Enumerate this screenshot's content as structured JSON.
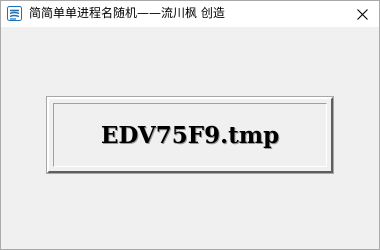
{
  "window": {
    "title": "简简单单进程名随机——流川枫 创造",
    "app_icon": "stacked-lines-app-icon",
    "close_icon": "close-icon"
  },
  "main": {
    "process_name": "EDV75F9.tmp"
  },
  "colors": {
    "icon_blue": "#1f6fb5",
    "window_bg": "#f0f0f0"
  }
}
